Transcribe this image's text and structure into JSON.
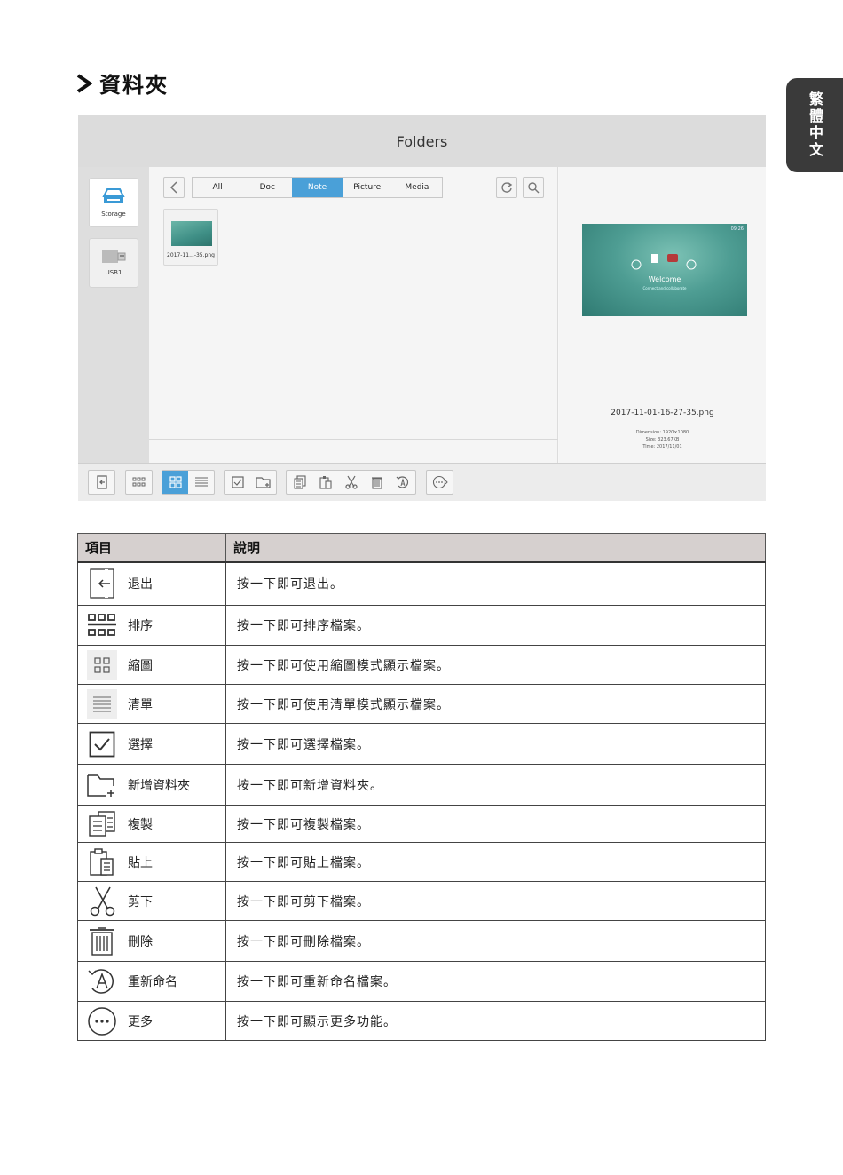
{
  "heading": {
    "title": "資料夾"
  },
  "language_tab": {
    "label": "繁體中文"
  },
  "screenshot": {
    "header_title": "Folders",
    "sources": [
      {
        "label": "Storage",
        "icon": "storage-icon"
      },
      {
        "label": "USB1",
        "icon": "usb-icon"
      }
    ],
    "tabs": [
      {
        "label": "All",
        "active": false
      },
      {
        "label": "Doc",
        "active": false
      },
      {
        "label": "Note",
        "active": true
      },
      {
        "label": "Picture",
        "active": false
      },
      {
        "label": "Media",
        "active": false
      }
    ],
    "file": {
      "name": "2017-11...-35.png"
    },
    "preview": {
      "welcome": "Welcome",
      "welcome_sub": "Connect and collaborate",
      "clock": "09:26",
      "filename": "2017-11-01-16-27-35.png",
      "dimension": "Dimension: 1920×1080",
      "size": "Size: 323.67KB",
      "time": "Time: 2017/11/01"
    },
    "accent_color": "#4aa0d8"
  },
  "table": {
    "headers": {
      "item": "項目",
      "desc": "說明"
    },
    "rows": [
      {
        "icon": "exit-icon",
        "item": "退出",
        "desc": "按一下即可退出。"
      },
      {
        "icon": "sort-icon",
        "item": "排序",
        "desc": "按一下即可排序檔案。"
      },
      {
        "icon": "thumbnail-icon",
        "item": "縮圖",
        "desc": "按一下即可使用縮圖模式顯示檔案。"
      },
      {
        "icon": "list-icon",
        "item": "清單",
        "desc": "按一下即可使用清單模式顯示檔案。"
      },
      {
        "icon": "select-icon",
        "item": "選擇",
        "desc": "按一下即可選擇檔案。"
      },
      {
        "icon": "new-folder-icon",
        "item": "新增資料夾",
        "desc": "按一下即可新增資料夾。"
      },
      {
        "icon": "copy-icon",
        "item": "複製",
        "desc": "按一下即可複製檔案。"
      },
      {
        "icon": "paste-icon",
        "item": "貼上",
        "desc": "按一下即可貼上檔案。"
      },
      {
        "icon": "cut-icon",
        "item": "剪下",
        "desc": "按一下即可剪下檔案。"
      },
      {
        "icon": "delete-icon",
        "item": "刪除",
        "desc": "按一下即可刪除檔案。"
      },
      {
        "icon": "rename-icon",
        "item": "重新命名",
        "desc": "按一下即可重新命名檔案。"
      },
      {
        "icon": "more-icon",
        "item": "更多",
        "desc": "按一下即可顯示更多功能。"
      }
    ]
  }
}
